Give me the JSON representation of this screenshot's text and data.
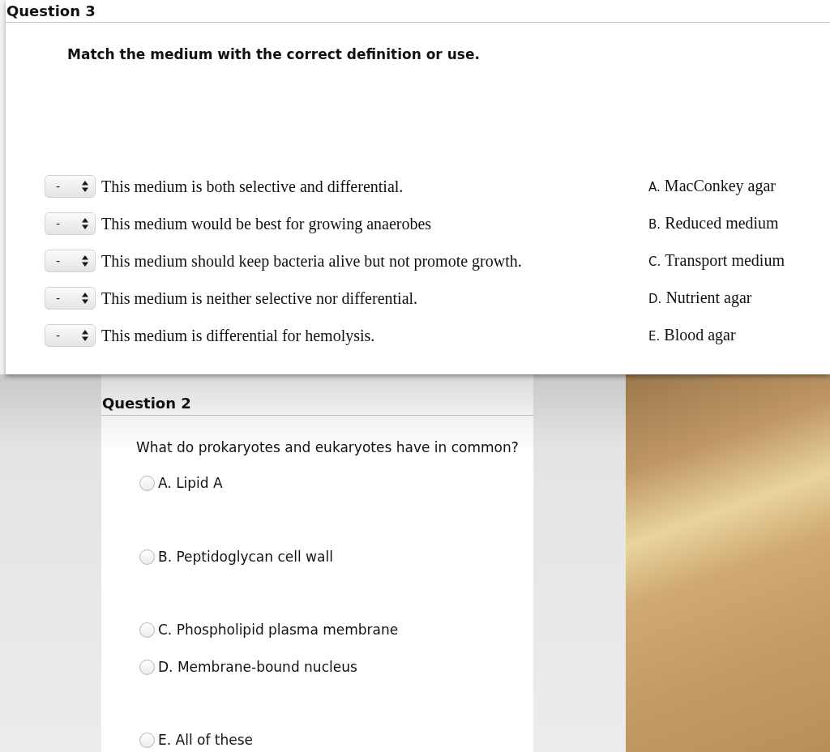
{
  "question_3": {
    "title": "Question 3",
    "prompt": "Match the medium with the correct definition or use.",
    "matches": [
      {
        "choice": "-",
        "statement": "This medium is both selective and differential."
      },
      {
        "choice": "-",
        "statement": "This medium would be best for growing anaerobes"
      },
      {
        "choice": "-",
        "statement": "This medium should keep bacteria alive but not promote growth."
      },
      {
        "choice": "-",
        "statement": "This medium is neither selective nor differential."
      },
      {
        "choice": "-",
        "statement": "This medium is differential for hemolysis."
      }
    ],
    "answers": [
      {
        "letter": "A.",
        "text": "MacConkey agar"
      },
      {
        "letter": "B.",
        "text": "Reduced medium"
      },
      {
        "letter": "C.",
        "text": "Transport medium"
      },
      {
        "letter": "D.",
        "text": "Nutrient agar"
      },
      {
        "letter": "E.",
        "text": "Blood agar"
      }
    ]
  },
  "question_2": {
    "title": "Question 2",
    "prompt": "What do prokaryotes and eukaryotes have in common?",
    "options": [
      {
        "label": "A. Lipid A",
        "selected": false
      },
      {
        "label": "B. Peptidoglycan cell wall",
        "selected": false
      },
      {
        "label": "C. Phospholipid plasma membrane",
        "selected": false
      },
      {
        "label": "D. Membrane-bound nucleus",
        "selected": false
      },
      {
        "label": "E. All of these",
        "selected": false
      }
    ]
  }
}
